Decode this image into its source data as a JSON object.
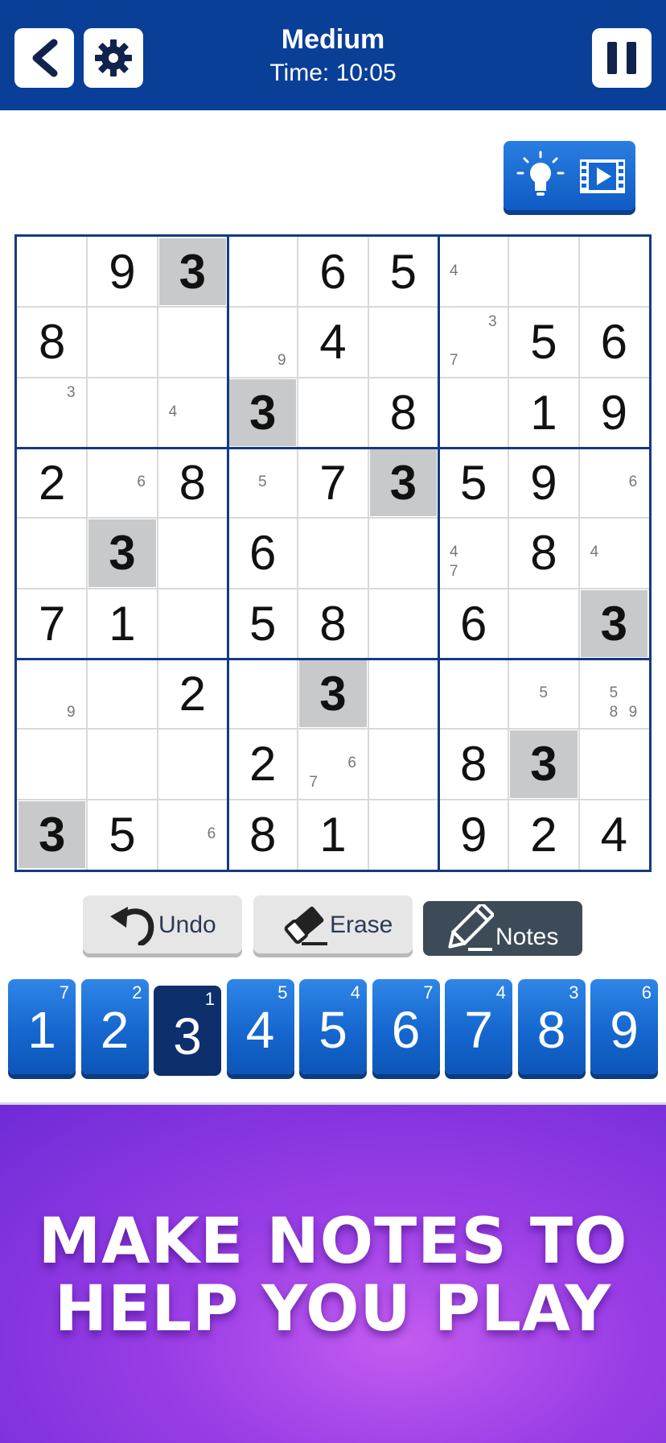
{
  "header": {
    "difficulty": "Medium",
    "time": "Time: 10:05",
    "back_icon": "chevron-left-icon",
    "settings_icon": "gear-icon",
    "pause_icon": "pause-icon"
  },
  "hint": {
    "bulb_icon": "lightbulb-icon",
    "video_icon": "video-play-icon"
  },
  "board": {
    "highlighted_digit": "3",
    "rows": [
      [
        "",
        "9",
        "3",
        "",
        "6",
        "5",
        "",
        "",
        ""
      ],
      [
        "8",
        "",
        "",
        "",
        "4",
        "",
        "",
        "5",
        "6"
      ],
      [
        "",
        "",
        "",
        "3",
        "",
        "8",
        "",
        "1",
        "9"
      ],
      [
        "2",
        "",
        "8",
        "",
        "7",
        "3",
        "5",
        "9",
        ""
      ],
      [
        "",
        "3",
        "",
        "6",
        "",
        "",
        "",
        "8",
        ""
      ],
      [
        "7",
        "1",
        "",
        "5",
        "8",
        "",
        "6",
        "",
        "3"
      ],
      [
        "",
        "",
        "2",
        "",
        "3",
        "",
        "",
        "",
        ""
      ],
      [
        "",
        "",
        "",
        "2",
        "",
        "",
        "8",
        "3",
        ""
      ],
      [
        "3",
        "5",
        "",
        "8",
        "1",
        "",
        "9",
        "2",
        "4"
      ]
    ],
    "notes": [
      {
        "r": 0,
        "c": 6,
        "digits": [
          "4"
        ]
      },
      {
        "r": 1,
        "c": 3,
        "digits": [
          "9"
        ]
      },
      {
        "r": 1,
        "c": 6,
        "digits": [
          "3",
          "7"
        ]
      },
      {
        "r": 2,
        "c": 0,
        "digits": [
          "3"
        ]
      },
      {
        "r": 2,
        "c": 2,
        "digits": [
          "4"
        ]
      },
      {
        "r": 3,
        "c": 1,
        "digits": [
          "6"
        ]
      },
      {
        "r": 3,
        "c": 3,
        "digits": [
          "5"
        ]
      },
      {
        "r": 3,
        "c": 8,
        "digits": [
          "6"
        ]
      },
      {
        "r": 4,
        "c": 6,
        "digits": [
          "4",
          "7"
        ]
      },
      {
        "r": 4,
        "c": 8,
        "digits": [
          "4"
        ]
      },
      {
        "r": 6,
        "c": 0,
        "digits": [
          "9"
        ]
      },
      {
        "r": 6,
        "c": 7,
        "digits": [
          "5"
        ]
      },
      {
        "r": 6,
        "c": 8,
        "digits": [
          "5",
          "8",
          "9"
        ]
      },
      {
        "r": 7,
        "c": 4,
        "digits": [
          "6",
          "7"
        ]
      },
      {
        "r": 8,
        "c": 2,
        "digits": [
          "6"
        ]
      }
    ]
  },
  "actions": {
    "undo": {
      "label": "Undo",
      "icon": "undo-arrow-icon"
    },
    "erase": {
      "label": "Erase",
      "icon": "eraser-icon"
    },
    "notes": {
      "label": "Notes",
      "icon": "pencil-icon",
      "active": true
    }
  },
  "numpad": [
    {
      "digit": "1",
      "count": "7"
    },
    {
      "digit": "2",
      "count": "2"
    },
    {
      "digit": "3",
      "count": "1",
      "selected": true
    },
    {
      "digit": "4",
      "count": "5"
    },
    {
      "digit": "5",
      "count": "4"
    },
    {
      "digit": "6",
      "count": "7"
    },
    {
      "digit": "7",
      "count": "4"
    },
    {
      "digit": "8",
      "count": "3"
    },
    {
      "digit": "9",
      "count": "6"
    }
  ],
  "promo": {
    "line1": "MAKE NOTES TO",
    "line2": "HELP YOU PLAY"
  },
  "colors": {
    "header_bg": "#0a3f98",
    "grid_border": "#153a82",
    "highlight": "#c8c9ca",
    "key_blue": "#1567cf",
    "key_selected": "#0d2f6c",
    "promo_purple": "#9a3ee6"
  }
}
